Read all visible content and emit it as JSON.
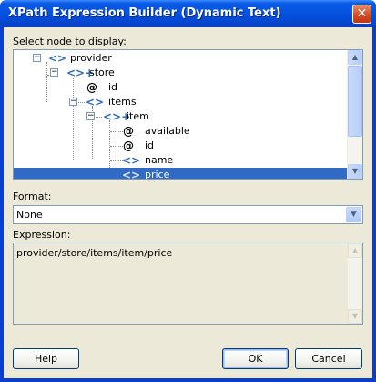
{
  "window": {
    "title": "XPath Expression Builder (Dynamic Text)",
    "close_glyph": "✕"
  },
  "tree_label": "Select node to display:",
  "tree": {
    "nodes": [
      {
        "label": "provider",
        "icon": "element-icon",
        "expander": "−"
      },
      {
        "label": "store",
        "icon": "element-multiple-icon",
        "expander": "−"
      },
      {
        "label": "id",
        "icon": "attribute-icon"
      },
      {
        "label": "items",
        "icon": "element-icon",
        "expander": "−"
      },
      {
        "label": "item",
        "icon": "element-multiple-icon",
        "expander": "−"
      },
      {
        "label": "available",
        "icon": "attribute-icon"
      },
      {
        "label": "id",
        "icon": "attribute-icon"
      },
      {
        "label": "name",
        "icon": "element-icon"
      },
      {
        "label": "price",
        "icon": "element-icon",
        "selected": true
      }
    ],
    "glyphs": {
      "element": "<>",
      "element_multiple": "<>+",
      "attribute": "@"
    },
    "scroll_up": "▲",
    "scroll_down": "▼"
  },
  "format": {
    "label": "Format:",
    "value": "None",
    "dropdown_glyph": "▼"
  },
  "expression": {
    "label": "Expression:",
    "value": "provider/store/items/item/price",
    "scroll_up": "▲",
    "scroll_down": "▼"
  },
  "buttons": {
    "help": "Help",
    "ok": "OK",
    "cancel": "Cancel"
  },
  "colors": {
    "titlebar": "#0554e0",
    "selection": "#316ac5",
    "dialog_bg": "#ece9d8",
    "field_border": "#7f9db9"
  }
}
